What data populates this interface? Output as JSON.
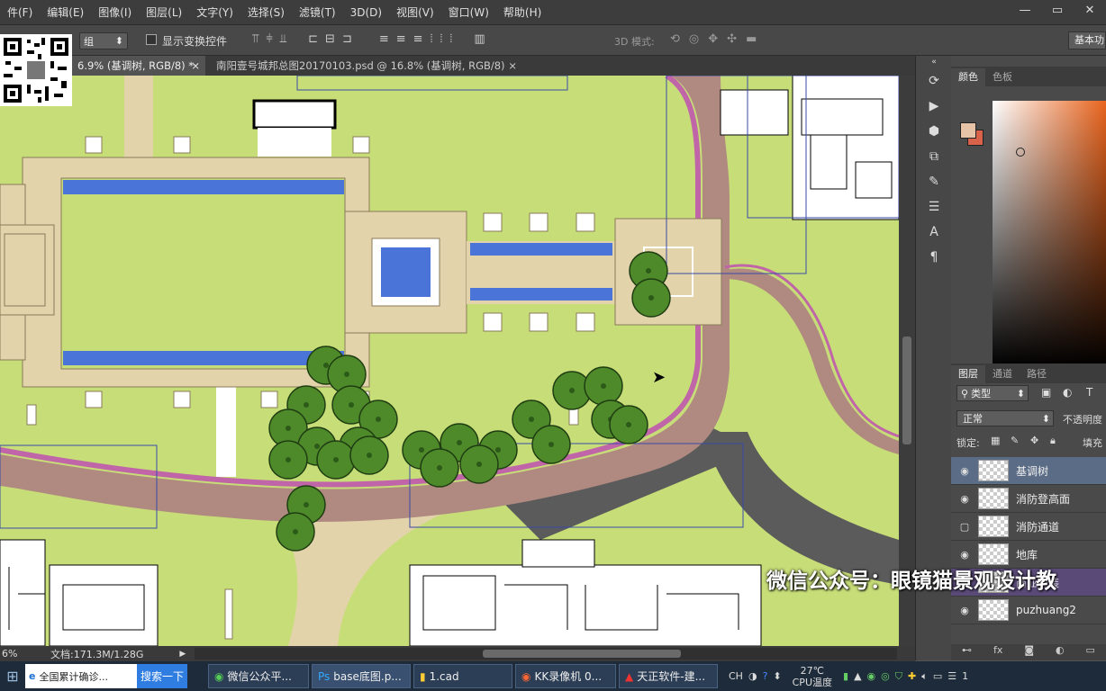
{
  "menu": [
    "件(F)",
    "编辑(E)",
    "图像(I)",
    "图层(L)",
    "文字(Y)",
    "选择(S)",
    "滤镜(T)",
    "3D(D)",
    "视图(V)",
    "窗口(W)",
    "帮助(H)"
  ],
  "options": {
    "auto_select_value": "组",
    "show_transform_label": "显示变换控件",
    "mode3d_label": "3D 模式:",
    "workspace": "基本功"
  },
  "tabs": [
    {
      "label": "6.9% (基调树, RGB/8) *",
      "close": "×"
    },
    {
      "label": "南阳壹号城邦总图20170103.psd @ 16.8% (基调树, RGB/8)",
      "close": "×"
    }
  ],
  "status": {
    "zoom": "6%",
    "doc": "文档:171.3M/1.28G"
  },
  "panels": {
    "color_tabs": [
      "颜色",
      "色板"
    ],
    "layer_tabs": [
      "图层",
      "通道",
      "路径"
    ],
    "filter_kind": "类型",
    "blend_mode": "正常",
    "opacity_label": "不透明度",
    "lock_label": "锁定:",
    "fill_label": "填充"
  },
  "layers": [
    {
      "name": "基调树",
      "visible": true,
      "selected": true
    },
    {
      "name": "消防登高面",
      "visible": true,
      "selected": false
    },
    {
      "name": "消防通道",
      "visible": false,
      "selected": false
    },
    {
      "name": "地库",
      "visible": true,
      "selected": false
    },
    {
      "name": "商业铺装",
      "visible": true,
      "selected": false
    },
    {
      "name": "puzhuang2",
      "visible": true,
      "selected": false
    }
  ],
  "watermark": "微信公众号：眼镜猫景观设计教",
  "taskbar": {
    "search_text": "全国累计确诊...",
    "search_button": "搜索一下",
    "items": [
      "微信公众平...",
      "base底图.p...",
      "1.cad",
      "KK录像机 0...",
      "天正软件-建..."
    ],
    "ime": "CH",
    "temp": "27℃",
    "temp_label": "CPU温度",
    "clock": "1"
  },
  "colors": {
    "grass": "#c7dd78",
    "paving": "#e3d3aa",
    "water": "#4a74d8",
    "path_pink": "#c066a8",
    "brick": "#b08a80",
    "road": "#5b5b5b",
    "tree": "#4e8a2a"
  }
}
